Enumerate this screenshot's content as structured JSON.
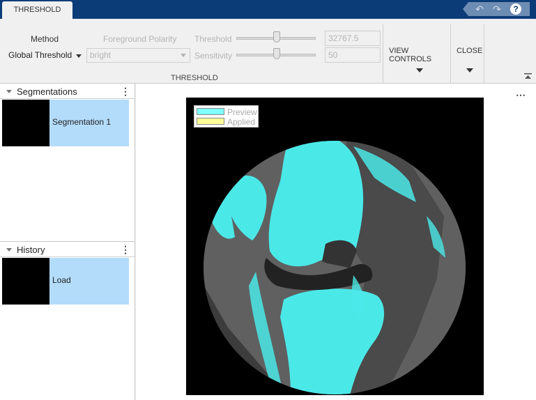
{
  "tab": {
    "label": "THRESHOLD"
  },
  "quick_access": {
    "undo_icon": "undo-icon",
    "redo_icon": "redo-icon",
    "help_label": "?"
  },
  "toolstrip": {
    "method_label": "Method",
    "method_value": "Global Threshold",
    "foreground_polarity_label": "Foreground Polarity",
    "foreground_polarity_value": "bright",
    "threshold_label": "Threshold",
    "threshold_value": "32767.5",
    "sensitivity_label": "Sensitivity",
    "sensitivity_value": "50",
    "section_title": "THRESHOLD",
    "view_controls_label": "VIEW CONTROLS",
    "close_label": "CLOSE"
  },
  "segmentations": {
    "title": "Segmentations",
    "items": [
      {
        "label": "Segmentation 1"
      }
    ]
  },
  "history": {
    "title": "History",
    "items": [
      {
        "label": "Load"
      }
    ]
  },
  "legend": {
    "preview_label": "Preview",
    "applied_label": "Applied",
    "preview_color": "#80ffff",
    "applied_color": "#ffff99"
  },
  "colors": {
    "titlebar": "#0c3c78",
    "selection": "#b3dcfb",
    "overlay": "#4be8e8"
  }
}
